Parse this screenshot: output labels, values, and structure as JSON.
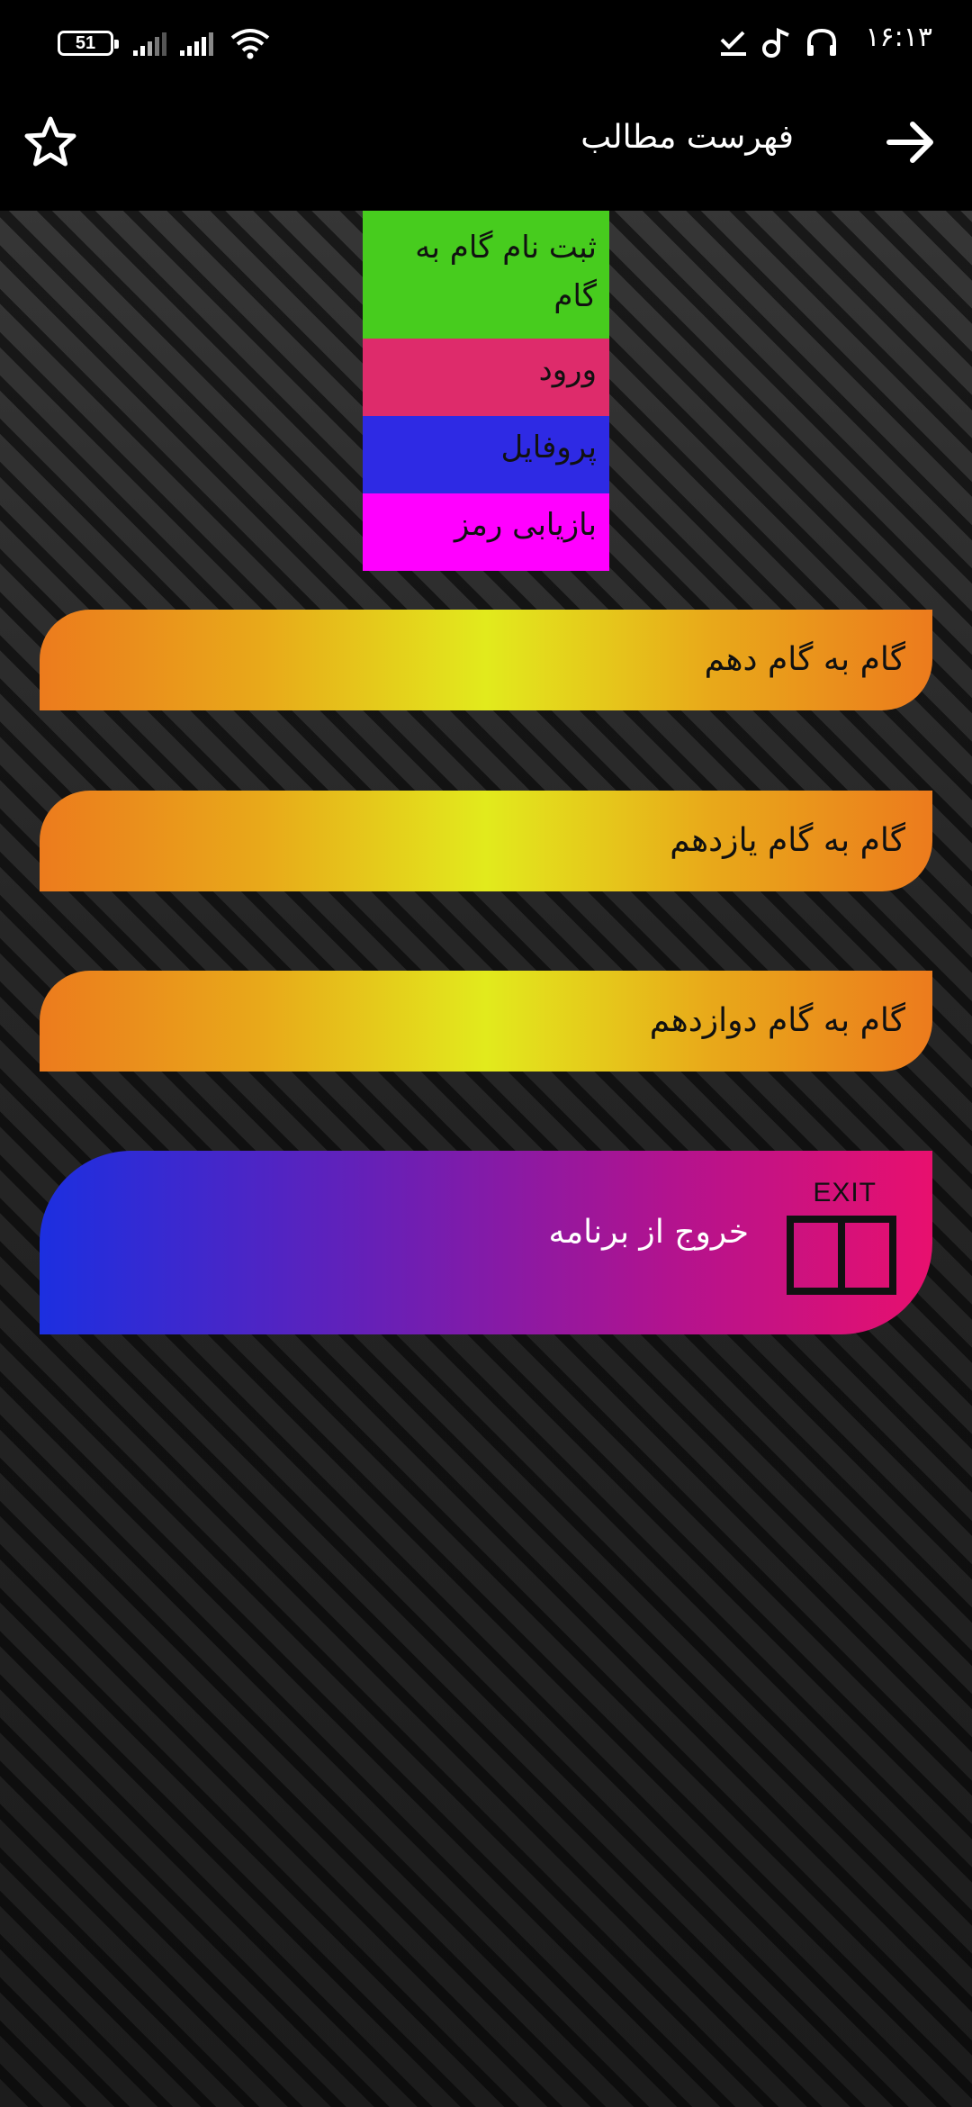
{
  "status_bar": {
    "battery": "51",
    "time": "۱۶:۱۳"
  },
  "toolbar": {
    "title": "فهرست مطالب"
  },
  "menu_items": [
    {
      "label": "ثبت نام  گام به گام",
      "color": "#47cc1e"
    },
    {
      "label": "ورود",
      "color": "#de2b6b"
    },
    {
      "label": "پروفایل",
      "color": "#2e2ae4"
    },
    {
      "label": "بازیابی رمز",
      "color": "#ff00ff"
    }
  ],
  "steps": [
    {
      "label": "گام به گام دهم"
    },
    {
      "label": "گام به گام یازدهم"
    },
    {
      "label": "گام به گام دوازدهم"
    }
  ],
  "exit": {
    "label": "خروج از برنامه",
    "icon_text": "EXIT"
  }
}
